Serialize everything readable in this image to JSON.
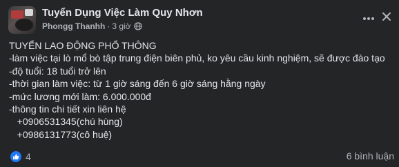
{
  "post": {
    "group_name": "Tuyển Dụng Việc Làm Quy Nhơn",
    "author": "Phongg Thanhh",
    "separator": "·",
    "time": "3 giờ",
    "lines": [
      "TUYỂN LAO ĐỘNG PHỔ THÔNG",
      "-làm việc tại lò mổ bò tập trung điện biên phủ, ko yêu cầu kinh nghiệm, sẽ được đào tạo",
      "-độ tuổi: 18 tuổi trở lên",
      "-thời gian làm việc: từ 1 giờ sáng đến 6 giờ sáng hằng ngày",
      "-mức lương mới làm: 6.000.000đ",
      "-thông tin chi tiết xin liên hệ",
      "   +0906531345(chú hùng)",
      "   +0986131773(cô huệ)"
    ]
  },
  "footer": {
    "reaction_count": "4",
    "comments_label": "6 bình luận"
  },
  "icons": {
    "globe": "globe-icon",
    "more": "more-options-icon",
    "close": "close-icon",
    "like": "like-icon"
  },
  "colors": {
    "background": "#242526",
    "text_primary": "#e4e6eb",
    "text_secondary": "#b0b3b8",
    "like_blue": "#2078f4"
  }
}
